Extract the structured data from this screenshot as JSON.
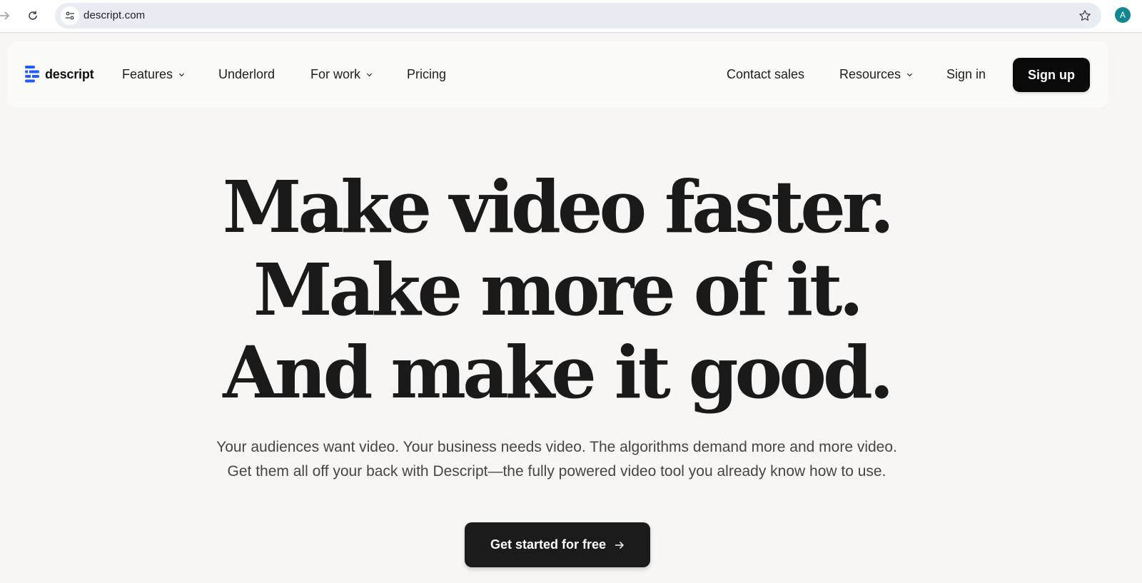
{
  "browser": {
    "url": "descript.com",
    "profile_initial": "A",
    "icons": {
      "forward": "arrow-right-icon",
      "reload": "reload-icon",
      "site_info": "tune-icon",
      "bookmark": "star-icon"
    }
  },
  "nav": {
    "logo_text": "descript",
    "brand_color": "#1f5cff",
    "left_items": [
      {
        "label": "Features",
        "has_dropdown": true
      },
      {
        "label": "Underlord",
        "has_dropdown": false
      },
      {
        "label": "For work",
        "has_dropdown": true
      },
      {
        "label": "Pricing",
        "has_dropdown": false
      }
    ],
    "right_items": [
      {
        "label": "Contact sales",
        "has_dropdown": false
      },
      {
        "label": "Resources",
        "has_dropdown": true
      },
      {
        "label": "Sign in",
        "has_dropdown": false
      }
    ],
    "signup_label": "Sign up"
  },
  "hero": {
    "headline": [
      "Make video faster.",
      "Make more of it.",
      "And make it good."
    ],
    "subheading": [
      "Your audiences want video. Your business needs video. The algorithms demand more and more video.",
      "Get them all off your back with Descript—the fully powered video tool you already know how to use."
    ],
    "cta_label": "Get started for free"
  }
}
